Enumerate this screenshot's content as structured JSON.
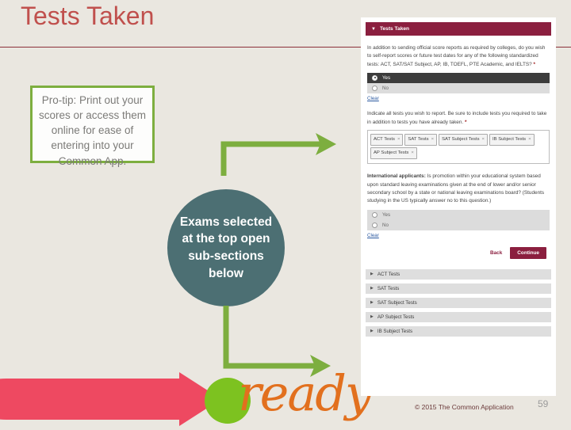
{
  "slide": {
    "title": "Tests Taken",
    "title_color": "#C0504D",
    "background_color": "#EAE7E0",
    "page_number": "59",
    "footer": "© 2015 The Common Application"
  },
  "callouts": {
    "protip": {
      "text": "Pro-tip: Print out your scores or access them online for ease of entering into your Common App.",
      "border_color": "#7DAE3F"
    },
    "circle": {
      "text": "Exams selected at the top open sub-sections below",
      "fill_color": "#4C6F73"
    }
  },
  "logo": {
    "word": "ready",
    "word_color": "#E2701E",
    "arrow_color": "#EE4961",
    "dot_color": "#7DC220"
  },
  "connectors": {
    "color": "#7DAE3F",
    "upper_label": "green-elbow-arrow-upper",
    "lower_label": "green-elbow-arrow-lower"
  },
  "app": {
    "panel_header": "Tests Taken",
    "header_color": "#8B1F3F",
    "question_1": "In addition to sending official score reports as required by colleges, do you wish to self-report scores or future test dates for any of the following standardized tests: ACT, SAT/SAT Subject, AP, IB, TOEFL, PTE Academic, and IELTS?",
    "question_1_options": [
      {
        "label": "Yes",
        "selected": true
      },
      {
        "label": "No",
        "selected": false
      }
    ],
    "clear_label": "Clear",
    "question_2": "Indicate all tests you wish to report. Be sure to include tests you required to take in addition to tests you have already taken.",
    "chips": [
      "ACT Tests",
      "SAT Tests",
      "SAT Subject Tests",
      "IB Subject Tests",
      "AP Subject Tests"
    ],
    "chip_remove_glyph": "×",
    "question_3_lead": "International applicants:",
    "question_3": " Is promotion within your educational system based upon standard leaving examinations given at the end of lower and/or senior secondary school by a state or national leaving examinations board? (Students studying in the US typically answer no to this question.)",
    "question_3_options": [
      {
        "label": "Yes",
        "selected": false
      },
      {
        "label": "No",
        "selected": false
      }
    ],
    "clear_label_2": "Clear",
    "back_label": "Back",
    "continue_label": "Continue",
    "accordion": [
      "ACT Tests",
      "SAT Tests",
      "SAT Subject Tests",
      "AP Subject Tests",
      "IB Subject Tests"
    ],
    "required_mark": "*",
    "caret_glyph": "▼",
    "triangle_glyph": "▶"
  }
}
